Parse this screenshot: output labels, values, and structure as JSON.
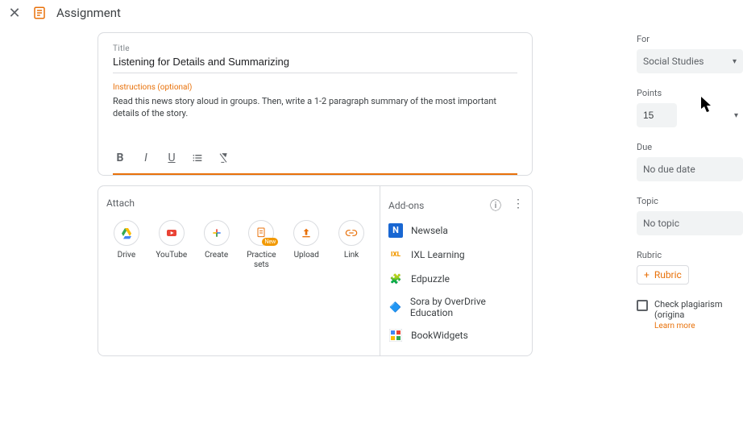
{
  "header": {
    "title": "Assignment"
  },
  "title_field": {
    "label": "Title",
    "value": "Listening for Details and Summarizing"
  },
  "instructions": {
    "label": "Instructions (optional)",
    "text": "Read this news story aloud in groups. Then, write a 1-2 paragraph summary of the most important details of the story."
  },
  "attach": {
    "heading": "Attach",
    "items": [
      {
        "name": "drive",
        "label": "Drive"
      },
      {
        "name": "youtube",
        "label": "YouTube"
      },
      {
        "name": "create",
        "label": "Create"
      },
      {
        "name": "practice",
        "label": "Practice sets",
        "badge": "New"
      },
      {
        "name": "upload",
        "label": "Upload"
      },
      {
        "name": "link",
        "label": "Link"
      }
    ]
  },
  "addons": {
    "heading": "Add-ons",
    "items": [
      {
        "name": "newsela",
        "label": "Newsela",
        "color": "#1967d2",
        "glyph": "N"
      },
      {
        "name": "ixl",
        "label": "IXL Learning",
        "color": "#f29900",
        "glyph": "IXL"
      },
      {
        "name": "edpuzzle",
        "label": "Edpuzzle",
        "color": "#f9ab00",
        "glyph": "●"
      },
      {
        "name": "sora",
        "label": "Sora by OverDrive Education",
        "color": "#4285f4",
        "glyph": "◆"
      },
      {
        "name": "bookwidgets",
        "label": "BookWidgets",
        "color": "#ea4335",
        "glyph": "▣"
      }
    ]
  },
  "sidebar": {
    "for": {
      "label": "For",
      "value": "Social Studies"
    },
    "points": {
      "label": "Points",
      "value": "15"
    },
    "due": {
      "label": "Due",
      "value": "No due date"
    },
    "topic": {
      "label": "Topic",
      "value": "No topic"
    },
    "rubric": {
      "label": "Rubric",
      "button": "Rubric"
    },
    "plagiarism": {
      "label": "Check plagiarism (origina",
      "learn": "Learn more"
    }
  }
}
